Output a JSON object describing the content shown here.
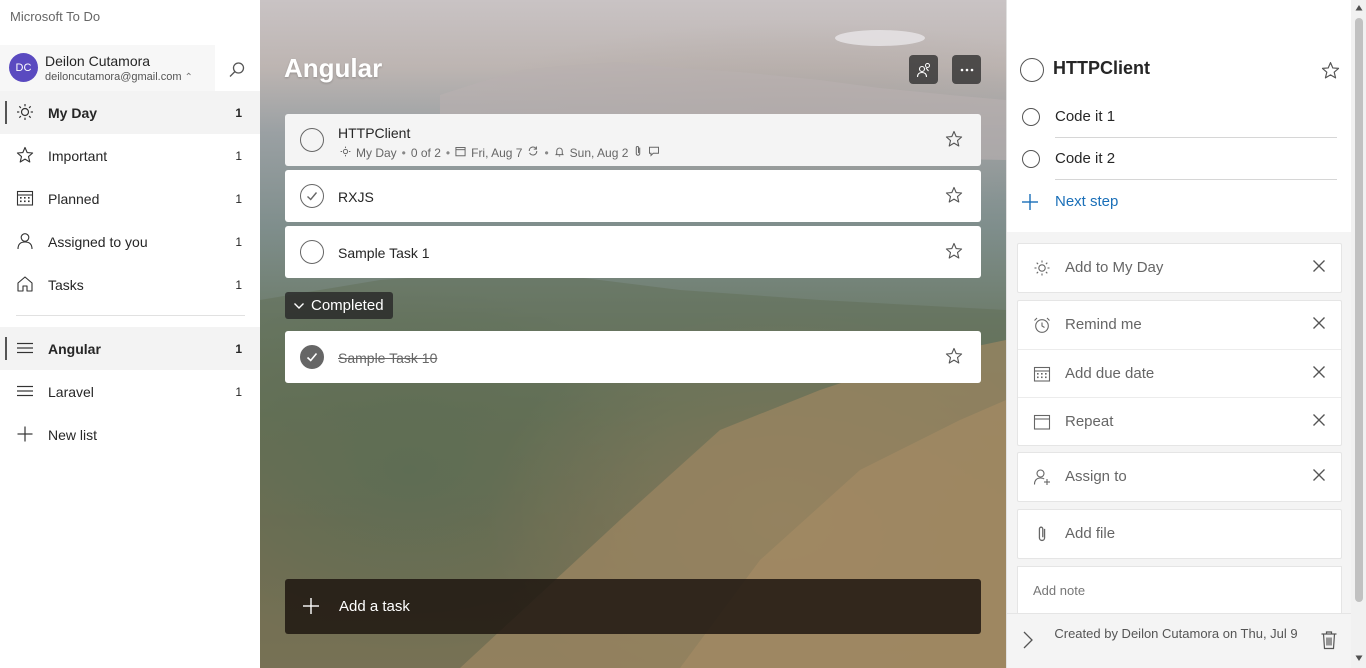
{
  "app": {
    "title": "Microsoft To Do"
  },
  "account": {
    "initials": "DC",
    "name": "Deilon Cutamora",
    "email": "deiloncutamora@gmail.com"
  },
  "nav": {
    "smart_lists": [
      {
        "label": "My Day",
        "count": "1",
        "icon": "sun-icon"
      },
      {
        "label": "Important",
        "count": "1",
        "icon": "star-icon"
      },
      {
        "label": "Planned",
        "count": "1",
        "icon": "calendar-icon"
      },
      {
        "label": "Assigned to you",
        "count": "1",
        "icon": "person-icon"
      },
      {
        "label": "Tasks",
        "count": "1",
        "icon": "home-icon"
      }
    ],
    "lists": [
      {
        "label": "Angular",
        "count": "1",
        "icon": "list-icon"
      },
      {
        "label": "Laravel",
        "count": "1",
        "icon": "list-icon"
      }
    ],
    "new_list": "New list"
  },
  "main": {
    "title": "Angular",
    "tasks": [
      {
        "title": "HTTPClient",
        "meta": {
          "myday": "My Day",
          "steps": "0 of 2",
          "due": "Fri, Aug 7",
          "reminder": "Sun, Aug 2"
        }
      },
      {
        "title": "RXJS"
      },
      {
        "title": "Sample Task 1"
      }
    ],
    "completed_label": "Completed",
    "completed_tasks": [
      {
        "title": "Sample Task 10"
      }
    ],
    "add_task": "Add a task"
  },
  "detail": {
    "title": "HTTPClient",
    "steps": [
      {
        "label": "Code it 1"
      },
      {
        "label": "Code it 2"
      }
    ],
    "next_step": "Next step",
    "add_to_my_day": "Add to My Day",
    "remind_me": "Remind me",
    "add_due_date": "Add due date",
    "repeat": "Repeat",
    "assign_to": "Assign to",
    "add_file": "Add file",
    "add_note": "Add note",
    "footer": "Created by Deilon Cutamora on Thu, Jul 9"
  },
  "colors": {
    "accent": "#1a6fb8",
    "avatar": "#5a4ac0"
  }
}
